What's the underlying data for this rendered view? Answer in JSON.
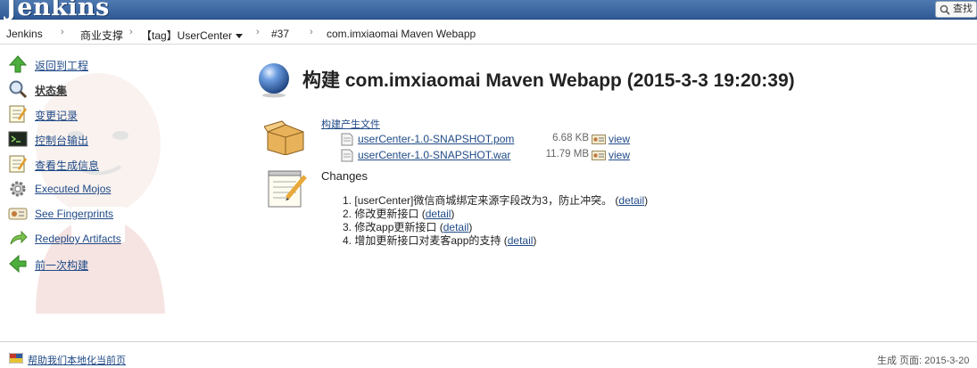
{
  "header": {
    "logo": "Jenkins",
    "search_label": "查找"
  },
  "breadcrumb": [
    {
      "label": "Jenkins"
    },
    {
      "label": "商业支撑"
    },
    {
      "label": "【tag】UserCenter"
    },
    {
      "label": "#37"
    },
    {
      "label": "com.imxiaomai Maven Webapp"
    }
  ],
  "sidebar": {
    "items": [
      {
        "label": "返回到工程",
        "icon": "up-arrow-icon"
      },
      {
        "label": "状态集",
        "icon": "magnifier-icon",
        "current": true
      },
      {
        "label": "变更记录",
        "icon": "notepad-icon"
      },
      {
        "label": "控制台输出",
        "icon": "terminal-icon"
      },
      {
        "label": "查看生成信息",
        "icon": "notepad-icon"
      },
      {
        "label": "Executed Mojos",
        "icon": "gear-icon"
      },
      {
        "label": "See Fingerprints",
        "icon": "fingerprint-icon"
      },
      {
        "label": "Redeploy Artifacts",
        "icon": "redeploy-icon"
      },
      {
        "label": "前一次构建",
        "icon": "left-arrow-icon"
      }
    ]
  },
  "main": {
    "title": "构建 com.imxiaomai Maven Webapp (2015-3-3 19:20:39)",
    "artifacts": {
      "heading": "构建产生文件",
      "files": [
        {
          "name": "userCenter-1.0-SNAPSHOT.pom",
          "size": "6.68 KB",
          "view": "view"
        },
        {
          "name": "userCenter-1.0-SNAPSHOT.war",
          "size": "11.79 MB",
          "view": "view"
        }
      ]
    },
    "changes": {
      "heading": "Changes",
      "items": [
        {
          "num": "1.",
          "text": "[userCenter]微信商城绑定来源字段改为3，防止冲突。",
          "detail": "detail"
        },
        {
          "num": "2.",
          "text": "修改更新接口",
          "detail": "detail"
        },
        {
          "num": "3.",
          "text": "修改app更新接口",
          "detail": "detail"
        },
        {
          "num": "4.",
          "text": "增加更新接口对麦客app的支持",
          "detail": "detail"
        }
      ]
    }
  },
  "footer": {
    "help_link": "帮助我们本地化当前页",
    "generated": "生成 页面: 2015-3-20"
  },
  "colors": {
    "header": "#3a659f",
    "link": "#204a87"
  }
}
